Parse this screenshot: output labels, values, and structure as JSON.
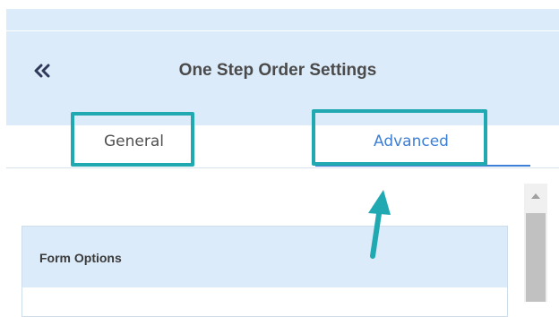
{
  "header": {
    "title": "One Step Order Settings",
    "collapse_icon": "double-chevron-left-icon"
  },
  "tabs": [
    {
      "label": "General",
      "active": false,
      "highlighted": true
    },
    {
      "label": "Advanced",
      "active": true,
      "highlighted": true
    }
  ],
  "annotations": {
    "highlight_color": "#21a9b1",
    "arrow_icon": "arrow-up-icon",
    "arrow_color": "#21a9b1"
  },
  "panel": {
    "card_title": "Form Options"
  },
  "colors": {
    "header_bg": "#dcebfa",
    "active_tab": "#3d7fd6"
  }
}
